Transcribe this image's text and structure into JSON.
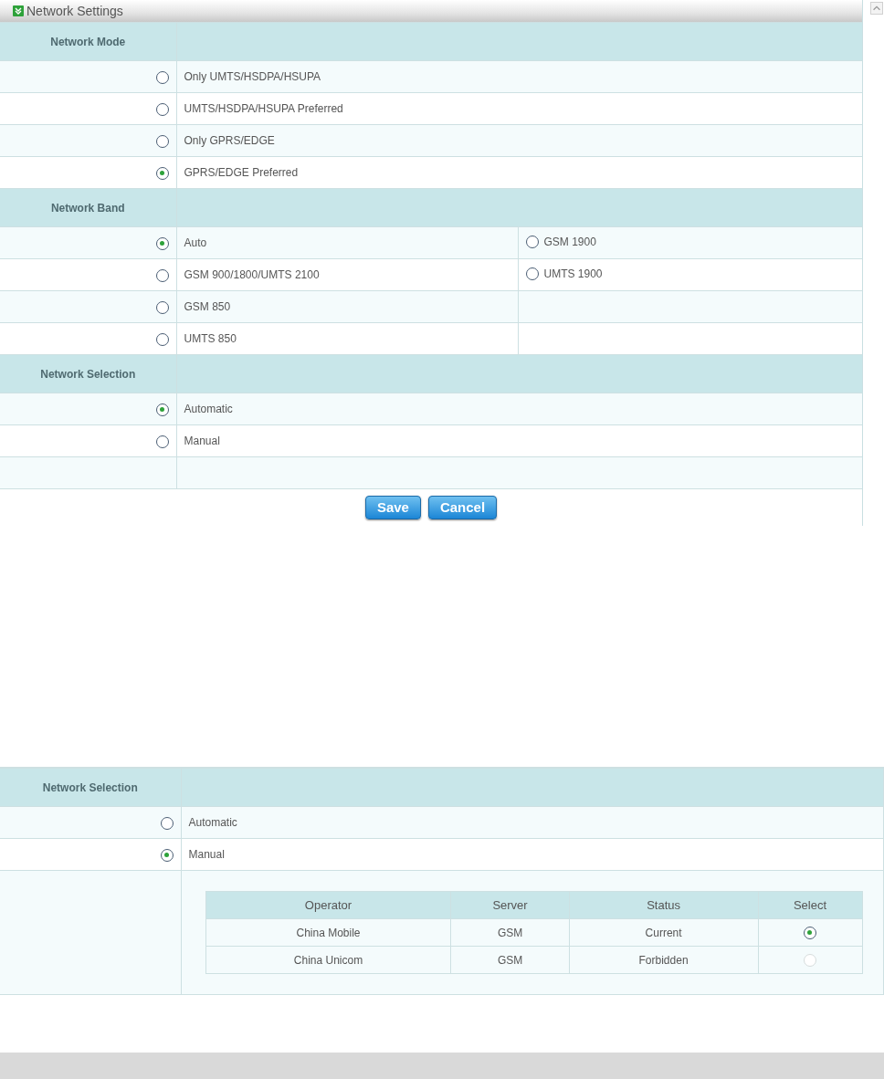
{
  "panel_title": "Network Settings",
  "sections": [
    {
      "heading": "Network Mode",
      "rows": [
        [
          {
            "label": "Only UMTS/HSDPA/HSUPA",
            "selected": false
          }
        ],
        [
          {
            "label": "UMTS/HSDPA/HSUPA Preferred",
            "selected": false
          }
        ],
        [
          {
            "label": "Only GPRS/EDGE",
            "selected": false
          }
        ],
        [
          {
            "label": "GPRS/EDGE Preferred",
            "selected": true
          }
        ]
      ]
    },
    {
      "heading": "Network Band",
      "rows": [
        [
          {
            "label": "Auto",
            "selected": true
          },
          {
            "label": "GSM 1900",
            "selected": false
          }
        ],
        [
          {
            "label": "GSM 900/1800/UMTS 2100",
            "selected": false
          },
          {
            "label": "UMTS 1900",
            "selected": false
          }
        ],
        [
          {
            "label": "GSM 850",
            "selected": false
          }
        ],
        [
          {
            "label": "UMTS 850",
            "selected": false
          }
        ]
      ]
    },
    {
      "heading": "Network Selection",
      "rows": [
        [
          {
            "label": "Automatic",
            "selected": true
          }
        ],
        [
          {
            "label": "Manual",
            "selected": false
          }
        ]
      ]
    }
  ],
  "buttons": [
    "Save",
    "Cancel"
  ],
  "manual_panel": {
    "heading": "Network Selection",
    "options": [
      {
        "label": "Automatic",
        "selected": false
      },
      {
        "label": "Manual",
        "selected": true
      }
    ],
    "operators": {
      "columns": [
        "Operator",
        "Server",
        "Status",
        "Select"
      ],
      "rows": [
        {
          "cells": [
            "China Mobile",
            "GSM",
            "Current"
          ],
          "selected": true,
          "disabled": false
        },
        {
          "cells": [
            "China Unicom",
            "GSM",
            "Forbidden"
          ],
          "selected": false,
          "disabled": true
        }
      ]
    }
  }
}
